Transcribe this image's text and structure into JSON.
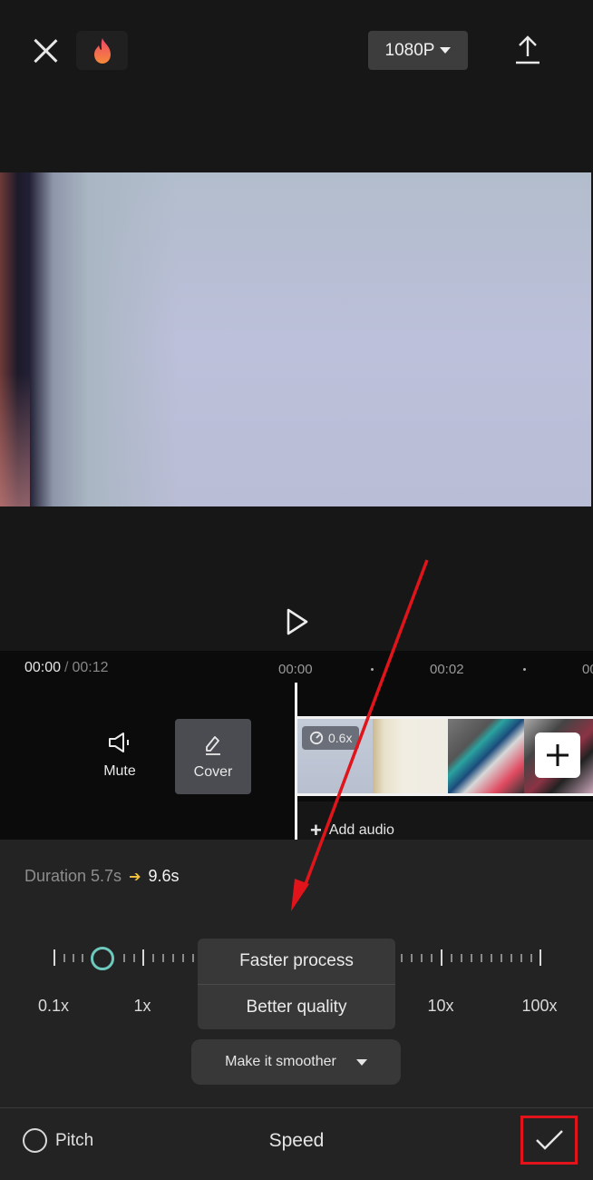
{
  "topbar": {
    "close_icon": "close-icon",
    "flame_icon": "flame-icon",
    "resolution": "1080P",
    "export_icon": "export-upload-icon"
  },
  "preview": {
    "play_icon": "play-icon"
  },
  "timeline": {
    "current_time": "00:00",
    "separator": "/",
    "total_time": "00:12",
    "ruler": [
      "00:00",
      "00:02",
      "00"
    ],
    "mute_label": "Mute",
    "cover_label": "Cover",
    "clip_speed_badge": "0.6x",
    "add_audio_label": "Add audio"
  },
  "speed_panel": {
    "duration_label": "Duration 5.7s",
    "duration_new": "9.6s",
    "scale_labels": [
      "0.1x",
      "1x",
      "10x",
      "100x"
    ],
    "current_speed": "0.6x",
    "menu_items": [
      "Faster process",
      "Better quality"
    ],
    "smooth_option": "Make it smoother",
    "pitch_label": "Pitch",
    "pitch_checked": false,
    "title": "Speed"
  },
  "colors": {
    "accent_teal": "#6ec9bd",
    "duration_arrow": "#f5c43a",
    "annotation_red": "#e0141a"
  }
}
